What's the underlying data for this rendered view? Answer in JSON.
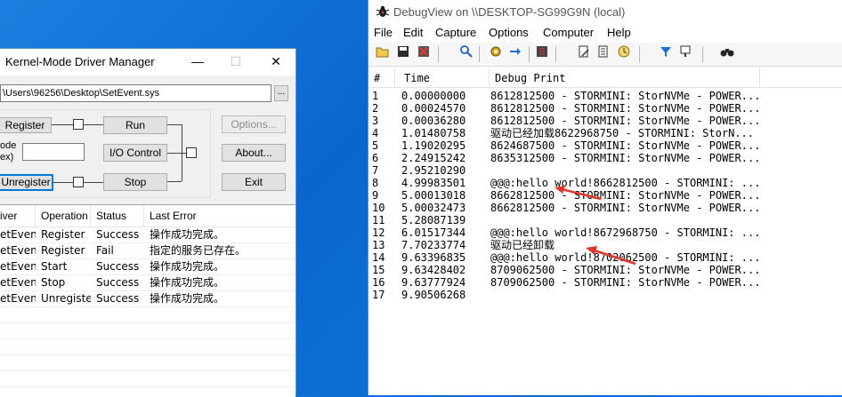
{
  "driver_manager": {
    "title": "Kernel-Mode Driver Manager",
    "title_buttons": {
      "minimize": "—",
      "maximize": "☐",
      "close": "✕"
    },
    "path_value": "\\Users\\96256\\Desktop\\SetEvent.sys",
    "browse_label": "...",
    "buttons": {
      "register": "Register",
      "run": "Run",
      "io_control": "I/O Control",
      "unregister": "Unregister",
      "stop": "Stop",
      "options": "Options...",
      "about": "About...",
      "exit": "Exit"
    },
    "code_label_1": "ode",
    "code_label_2": "ex)",
    "list_headers": [
      "iver",
      "Operation",
      "Status",
      "Last Error"
    ],
    "list_rows": [
      [
        "etEvent",
        "Register",
        "Success",
        "操作成功完成。"
      ],
      [
        "etEvent",
        "Register",
        "Fail",
        "指定的服务已存在。"
      ],
      [
        "etEvent",
        "Start",
        "Success",
        "操作成功完成。"
      ],
      [
        "etEvent",
        "Stop",
        "Success",
        "操作成功完成。"
      ],
      [
        "etEvent",
        "Unregister",
        "Success",
        "操作成功完成。"
      ]
    ]
  },
  "debugview": {
    "title": "DebugView on \\\\DESKTOP-SG99G9N (local)",
    "menu": [
      "File",
      "Edit",
      "Capture",
      "Options",
      "Computer",
      "Help"
    ],
    "columns": [
      "#",
      "Time",
      "Debug Print"
    ],
    "rows": [
      [
        "1",
        "0.00000000",
        "8612812500 - STORMINI: StorNVMe - POWER..."
      ],
      [
        "2",
        "0.00024570",
        "8612812500 - STORMINI: StorNVMe - POWER..."
      ],
      [
        "3",
        "0.00036280",
        "8612812500 - STORMINI: StorNVMe - POWER..."
      ],
      [
        "4",
        "1.01480758",
        "驱动已经加载8622968750 - STORMINI: StorN..."
      ],
      [
        "5",
        "1.19020295",
        "8624687500 - STORMINI: StorNVMe - POWER..."
      ],
      [
        "6",
        "2.24915242",
        "8635312500 - STORMINI: StorNVMe - POWER..."
      ],
      [
        "7",
        "2.95210290",
        ""
      ],
      [
        "8",
        "4.99983501",
        "@@@:hello world!8662812500 - STORMINI: ..."
      ],
      [
        "9",
        "5.00013018",
        "8662812500 - STORMINI: StorNVMe - POWER..."
      ],
      [
        "10",
        "5.00032473",
        "8662812500 - STORMINI: StorNVMe - POWER..."
      ],
      [
        "11",
        "5.28087139",
        ""
      ],
      [
        "12",
        "6.01517344",
        "@@@:hello world!8672968750 - STORMINI: ..."
      ],
      [
        "13",
        "7.70233774",
        "驱动已经卸载"
      ],
      [
        "14",
        "9.63396835",
        "@@@:hello world!8702062500 - STORMINI: ..."
      ],
      [
        "15",
        "9.63428402",
        "8709062500 - STORMINI: StorNVMe - POWER..."
      ],
      [
        "16",
        "9.63777924",
        "8709062500 - STORMINI: StorNVMe - POWER..."
      ],
      [
        "17",
        "9.90506268",
        ""
      ]
    ],
    "accent_color": "#e0362a"
  }
}
